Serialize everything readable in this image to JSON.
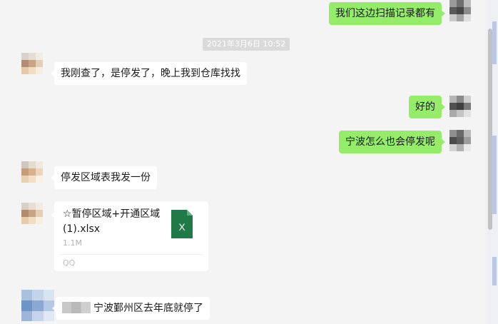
{
  "timestamp": "2021年3月6日 10:52",
  "messages": [
    {
      "id": "m1",
      "side": "right",
      "text": "我们这边扫描记录都有"
    },
    {
      "id": "m2",
      "side": "left",
      "text": "我刚查了，是停发了，晚上我到仓库找找"
    },
    {
      "id": "m3",
      "side": "right",
      "text": "好的"
    },
    {
      "id": "m4",
      "side": "right",
      "text": "宁波怎么也会停发呢"
    },
    {
      "id": "m5",
      "side": "left",
      "text": "停发区域表我发一份"
    },
    {
      "id": "m7",
      "side": "left",
      "text": "宁波鄞州区去年底就停了"
    }
  ],
  "file_message": {
    "name": "☆暂停区域+开通区域(1).xlsx",
    "size": "1.1M",
    "source": "QQ",
    "icon": "excel-file-icon",
    "icon_letter": "X",
    "icon_color": "#1f7a47"
  },
  "colors": {
    "sent_bubble": "#95ec69",
    "received_bubble": "#ffffff",
    "background": "#f4f4f4"
  }
}
